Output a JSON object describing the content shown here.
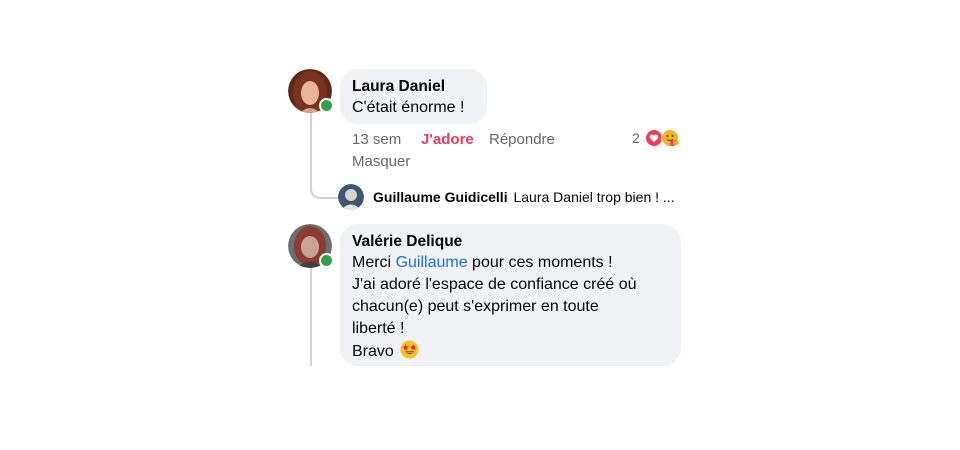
{
  "colors": {
    "bubble": "#f0f2f5",
    "love": "#e4405f",
    "mention": "#216fdb",
    "online": "#31a24c",
    "meta": "#65676b"
  },
  "comments": [
    {
      "author": "Laura Daniel",
      "text": "C'était énorme !",
      "online": true,
      "actions": {
        "time": "13 sem",
        "love": "J'adore",
        "reply": "Répondre",
        "hide": "Masquer"
      },
      "reactions": {
        "count": "2",
        "icons": [
          "heart-reaction-icon",
          "care-reaction-icon"
        ]
      }
    },
    {
      "author": "Valérie Delique",
      "online": true,
      "lines": {
        "line1_before": "Merci",
        "line1_mention": "Guillaume",
        "line1_after": "pour ces moments !",
        "line2": "J'ai adoré l'espace de confiance créé où",
        "line3": "chacun(e) peut s'exprimer en toute",
        "line4": "liberté !",
        "line5": "Bravo",
        "emoji": "star-struck-emoji-icon"
      }
    }
  ],
  "reply_preview": {
    "author": "Guillaume Guidicelli",
    "text": "Laura Daniel trop bien ! ..."
  }
}
